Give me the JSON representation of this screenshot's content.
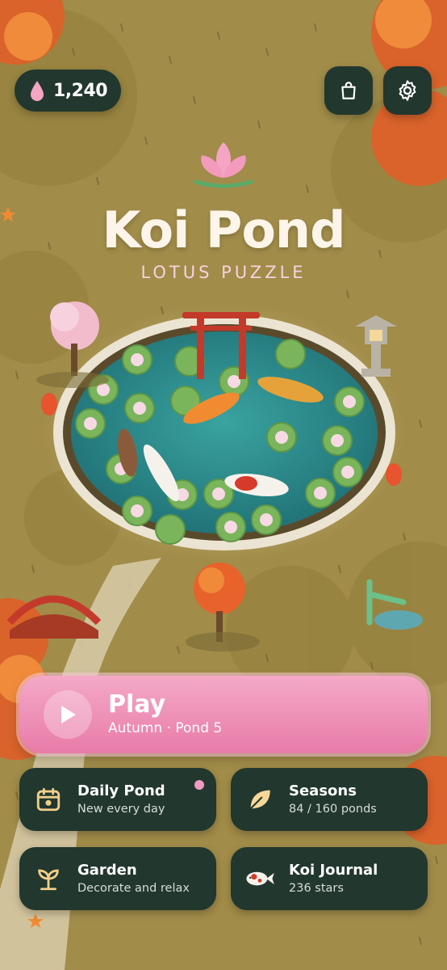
{
  "currency": {
    "icon": "lotus-petal-icon",
    "value": "1,240"
  },
  "header": {
    "shop_icon": "shopping-bag-icon",
    "settings_icon": "gear-icon"
  },
  "title": {
    "main": "Koi Pond",
    "subtitle": "LOTUS PUZZLE",
    "logo": "lotus-icon"
  },
  "scene": {
    "description_icons": [
      "torii-gate",
      "koi-fish",
      "lily-pad",
      "stone-lantern",
      "red-bridge",
      "maple-tree",
      "paper-lantern"
    ]
  },
  "play": {
    "label": "Play",
    "subtitle": "Autumn · Pond 5",
    "icon": "play-icon"
  },
  "menu": [
    {
      "title": "Daily Pond",
      "subtitle": "New every day",
      "icon": "calendar-icon",
      "badge": true
    },
    {
      "title": "Seasons",
      "subtitle": "84 / 160 ponds",
      "icon": "leaf-icon"
    },
    {
      "title": "Garden",
      "subtitle": "Decorate and relax",
      "icon": "sprout-icon"
    },
    {
      "title": "Koi Journal",
      "subtitle": "236 stars",
      "icon": "koi-icon"
    }
  ],
  "colors": {
    "accent_pink": "#f08db5",
    "panel": "#22372e",
    "ground": "#a18c49",
    "water": "#2f8c8e"
  }
}
